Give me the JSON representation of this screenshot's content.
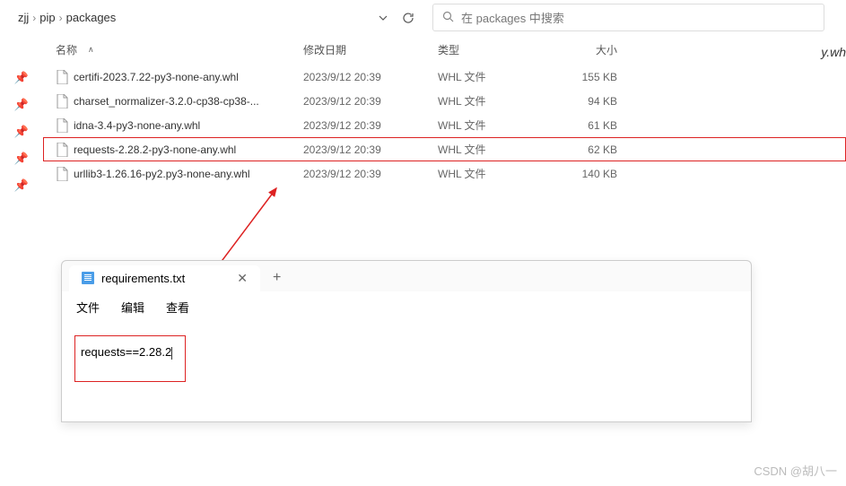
{
  "breadcrumbs": [
    "zjj",
    "pip",
    "packages"
  ],
  "search": {
    "placeholder": "在 packages 中搜索"
  },
  "columns": {
    "name": "名称",
    "date": "修改日期",
    "type": "类型",
    "size": "大小"
  },
  "files": [
    {
      "name": "certifi-2023.7.22-py3-none-any.whl",
      "date": "2023/9/12 20:39",
      "type": "WHL 文件",
      "size": "155 KB",
      "hl": false
    },
    {
      "name": "charset_normalizer-3.2.0-cp38-cp38-...",
      "date": "2023/9/12 20:39",
      "type": "WHL 文件",
      "size": "94 KB",
      "hl": false
    },
    {
      "name": "idna-3.4-py3-none-any.whl",
      "date": "2023/9/12 20:39",
      "type": "WHL 文件",
      "size": "61 KB",
      "hl": false
    },
    {
      "name": "requests-2.28.2-py3-none-any.whl",
      "date": "2023/9/12 20:39",
      "type": "WHL 文件",
      "size": "62 KB",
      "hl": true
    },
    {
      "name": "urllib3-1.26.16-py2.py3-none-any.whl",
      "date": "2023/9/12 20:39",
      "type": "WHL 文件",
      "size": "140 KB",
      "hl": false
    }
  ],
  "notepad": {
    "tab_title": "requirements.txt",
    "menu": [
      "文件",
      "编辑",
      "查看"
    ],
    "content": "requests==2.28.2"
  },
  "right_sliver": "y.wh",
  "watermark": "CSDN @胡八一"
}
